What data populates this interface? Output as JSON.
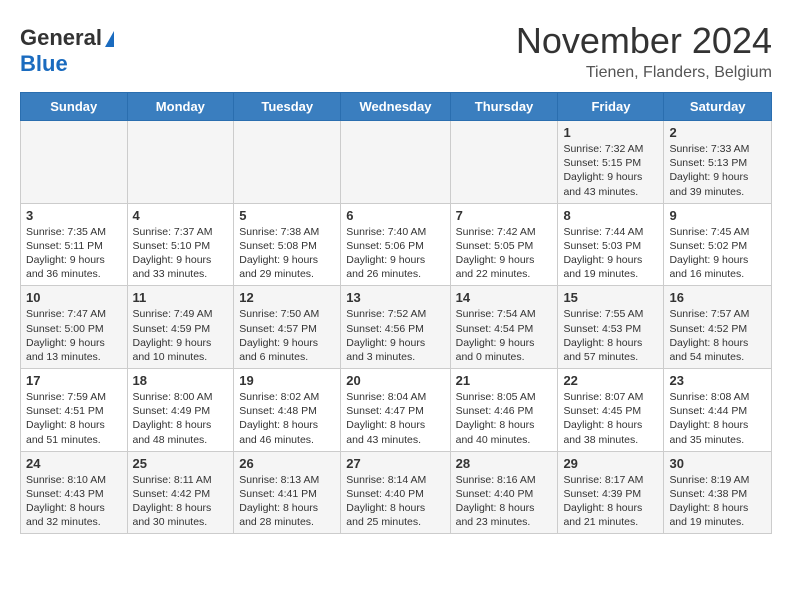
{
  "header": {
    "logo_line1": "General",
    "logo_line2": "Blue",
    "month_title": "November 2024",
    "location": "Tienen, Flanders, Belgium"
  },
  "days_of_week": [
    "Sunday",
    "Monday",
    "Tuesday",
    "Wednesday",
    "Thursday",
    "Friday",
    "Saturday"
  ],
  "weeks": [
    [
      {
        "day": "",
        "sunrise": "",
        "sunset": "",
        "daylight": ""
      },
      {
        "day": "",
        "sunrise": "",
        "sunset": "",
        "daylight": ""
      },
      {
        "day": "",
        "sunrise": "",
        "sunset": "",
        "daylight": ""
      },
      {
        "day": "",
        "sunrise": "",
        "sunset": "",
        "daylight": ""
      },
      {
        "day": "",
        "sunrise": "",
        "sunset": "",
        "daylight": ""
      },
      {
        "day": "1",
        "sunrise": "7:32 AM",
        "sunset": "5:15 PM",
        "daylight": "9 hours and 43 minutes."
      },
      {
        "day": "2",
        "sunrise": "7:33 AM",
        "sunset": "5:13 PM",
        "daylight": "9 hours and 39 minutes."
      }
    ],
    [
      {
        "day": "3",
        "sunrise": "7:35 AM",
        "sunset": "5:11 PM",
        "daylight": "9 hours and 36 minutes."
      },
      {
        "day": "4",
        "sunrise": "7:37 AM",
        "sunset": "5:10 PM",
        "daylight": "9 hours and 33 minutes."
      },
      {
        "day": "5",
        "sunrise": "7:38 AM",
        "sunset": "5:08 PM",
        "daylight": "9 hours and 29 minutes."
      },
      {
        "day": "6",
        "sunrise": "7:40 AM",
        "sunset": "5:06 PM",
        "daylight": "9 hours and 26 minutes."
      },
      {
        "day": "7",
        "sunrise": "7:42 AM",
        "sunset": "5:05 PM",
        "daylight": "9 hours and 22 minutes."
      },
      {
        "day": "8",
        "sunrise": "7:44 AM",
        "sunset": "5:03 PM",
        "daylight": "9 hours and 19 minutes."
      },
      {
        "day": "9",
        "sunrise": "7:45 AM",
        "sunset": "5:02 PM",
        "daylight": "9 hours and 16 minutes."
      }
    ],
    [
      {
        "day": "10",
        "sunrise": "7:47 AM",
        "sunset": "5:00 PM",
        "daylight": "9 hours and 13 minutes."
      },
      {
        "day": "11",
        "sunrise": "7:49 AM",
        "sunset": "4:59 PM",
        "daylight": "9 hours and 10 minutes."
      },
      {
        "day": "12",
        "sunrise": "7:50 AM",
        "sunset": "4:57 PM",
        "daylight": "9 hours and 6 minutes."
      },
      {
        "day": "13",
        "sunrise": "7:52 AM",
        "sunset": "4:56 PM",
        "daylight": "9 hours and 3 minutes."
      },
      {
        "day": "14",
        "sunrise": "7:54 AM",
        "sunset": "4:54 PM",
        "daylight": "9 hours and 0 minutes."
      },
      {
        "day": "15",
        "sunrise": "7:55 AM",
        "sunset": "4:53 PM",
        "daylight": "8 hours and 57 minutes."
      },
      {
        "day": "16",
        "sunrise": "7:57 AM",
        "sunset": "4:52 PM",
        "daylight": "8 hours and 54 minutes."
      }
    ],
    [
      {
        "day": "17",
        "sunrise": "7:59 AM",
        "sunset": "4:51 PM",
        "daylight": "8 hours and 51 minutes."
      },
      {
        "day": "18",
        "sunrise": "8:00 AM",
        "sunset": "4:49 PM",
        "daylight": "8 hours and 48 minutes."
      },
      {
        "day": "19",
        "sunrise": "8:02 AM",
        "sunset": "4:48 PM",
        "daylight": "8 hours and 46 minutes."
      },
      {
        "day": "20",
        "sunrise": "8:04 AM",
        "sunset": "4:47 PM",
        "daylight": "8 hours and 43 minutes."
      },
      {
        "day": "21",
        "sunrise": "8:05 AM",
        "sunset": "4:46 PM",
        "daylight": "8 hours and 40 minutes."
      },
      {
        "day": "22",
        "sunrise": "8:07 AM",
        "sunset": "4:45 PM",
        "daylight": "8 hours and 38 minutes."
      },
      {
        "day": "23",
        "sunrise": "8:08 AM",
        "sunset": "4:44 PM",
        "daylight": "8 hours and 35 minutes."
      }
    ],
    [
      {
        "day": "24",
        "sunrise": "8:10 AM",
        "sunset": "4:43 PM",
        "daylight": "8 hours and 32 minutes."
      },
      {
        "day": "25",
        "sunrise": "8:11 AM",
        "sunset": "4:42 PM",
        "daylight": "8 hours and 30 minutes."
      },
      {
        "day": "26",
        "sunrise": "8:13 AM",
        "sunset": "4:41 PM",
        "daylight": "8 hours and 28 minutes."
      },
      {
        "day": "27",
        "sunrise": "8:14 AM",
        "sunset": "4:40 PM",
        "daylight": "8 hours and 25 minutes."
      },
      {
        "day": "28",
        "sunrise": "8:16 AM",
        "sunset": "4:40 PM",
        "daylight": "8 hours and 23 minutes."
      },
      {
        "day": "29",
        "sunrise": "8:17 AM",
        "sunset": "4:39 PM",
        "daylight": "8 hours and 21 minutes."
      },
      {
        "day": "30",
        "sunrise": "8:19 AM",
        "sunset": "4:38 PM",
        "daylight": "8 hours and 19 minutes."
      }
    ]
  ],
  "labels": {
    "sunrise": "Sunrise:",
    "sunset": "Sunset:",
    "daylight": "Daylight:"
  }
}
